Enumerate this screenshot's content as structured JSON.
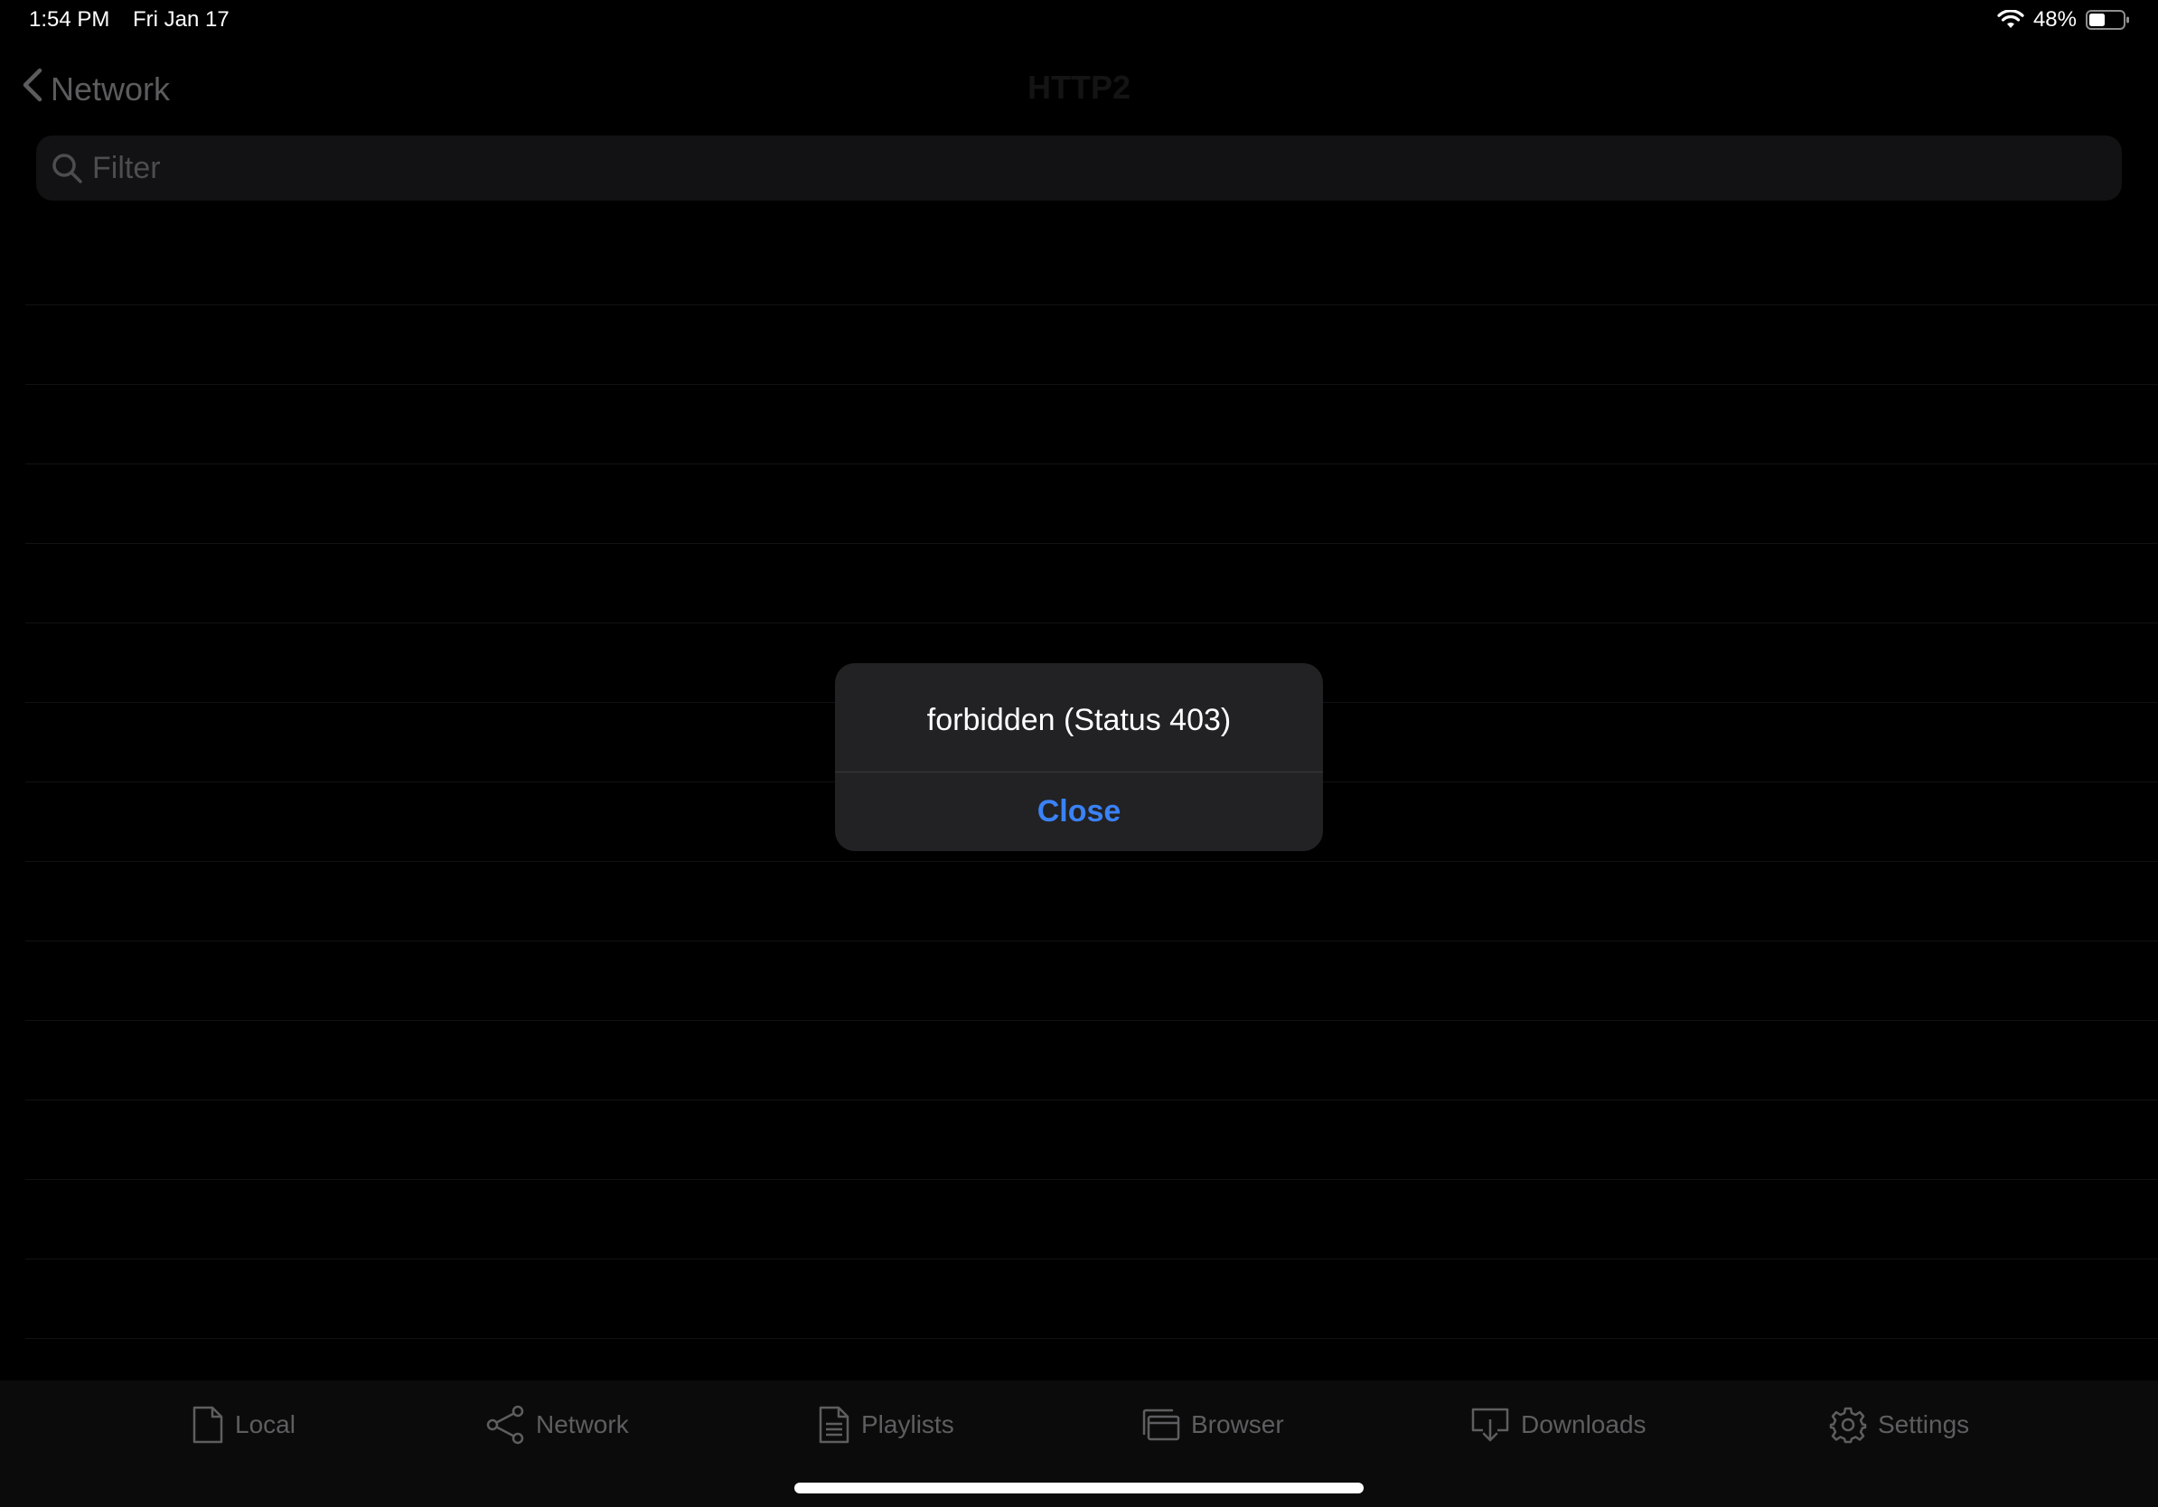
{
  "status_bar": {
    "time": "1:54 PM",
    "date": "Fri Jan 17",
    "battery": "48%",
    "battery_level": 0.48
  },
  "nav": {
    "back_label": "Network",
    "title": "HTTP2"
  },
  "search": {
    "placeholder": "Filter"
  },
  "alert": {
    "message": "forbidden (Status 403)",
    "close_label": "Close",
    "accent": "#3a82f7"
  },
  "tabs": [
    {
      "label": "Local",
      "icon": "document-icon"
    },
    {
      "label": "Network",
      "icon": "share-icon"
    },
    {
      "label": "Playlists",
      "icon": "list-document-icon"
    },
    {
      "label": "Browser",
      "icon": "browser-window-icon"
    },
    {
      "label": "Downloads",
      "icon": "download-tray-icon"
    },
    {
      "label": "Settings",
      "icon": "gear-icon"
    }
  ]
}
